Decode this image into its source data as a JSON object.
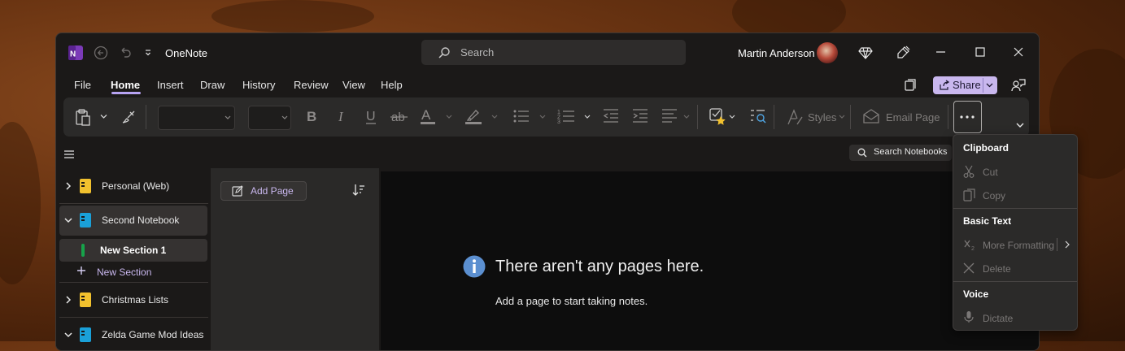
{
  "window": {
    "app_title": "OneNote"
  },
  "search": {
    "placeholder": "Search"
  },
  "user": {
    "name": "Martin Anderson"
  },
  "menu_tabs": [
    {
      "label": "File"
    },
    {
      "label": "Home",
      "active": true
    },
    {
      "label": "Insert"
    },
    {
      "label": "Draw"
    },
    {
      "label": "History"
    },
    {
      "label": "Review"
    },
    {
      "label": "View"
    },
    {
      "label": "Help"
    }
  ],
  "share": {
    "label": "Share"
  },
  "ribbon": {
    "styles_label": "Styles",
    "email_page_label": "Email Page",
    "font_value": "",
    "size_value": ""
  },
  "search_notebooks": {
    "label": "Search Notebooks"
  },
  "notebooks": [
    {
      "label": "Personal (Web)",
      "color": "#f2c12e",
      "expanded": false
    },
    {
      "label": "Second Notebook",
      "color": "#1aa0d8",
      "expanded": true
    },
    {
      "label": "Christmas Lists",
      "color": "#f2c12e",
      "expanded": false
    },
    {
      "label": "Zelda Game Mod Ideas",
      "color": "#1aa0d8",
      "expanded": true
    }
  ],
  "sections": {
    "active": "New Section 1",
    "active_color": "#17a34a",
    "new_section_label": "New Section"
  },
  "pages_pane": {
    "add_page_label": "Add Page"
  },
  "canvas": {
    "empty_title": "There aren't any pages here.",
    "empty_subtitle": "Add a page to start taking notes."
  },
  "overflow_menu": {
    "groups": [
      {
        "header": "Clipboard",
        "items": [
          {
            "label": "Cut",
            "icon": "scissors-icon"
          },
          {
            "label": "Copy",
            "icon": "copy-icon"
          }
        ]
      },
      {
        "header": "Basic Text",
        "items": [
          {
            "label": "More Formatting",
            "icon": "subscript-icon"
          },
          {
            "label": "Delete",
            "icon": "x-icon"
          }
        ]
      },
      {
        "header": "Voice",
        "items": [
          {
            "label": "Dictate",
            "icon": "microphone-icon"
          }
        ]
      }
    ]
  },
  "colors": {
    "accent": "#c9b7ee",
    "onenote_purple": "#7b3ab8"
  }
}
